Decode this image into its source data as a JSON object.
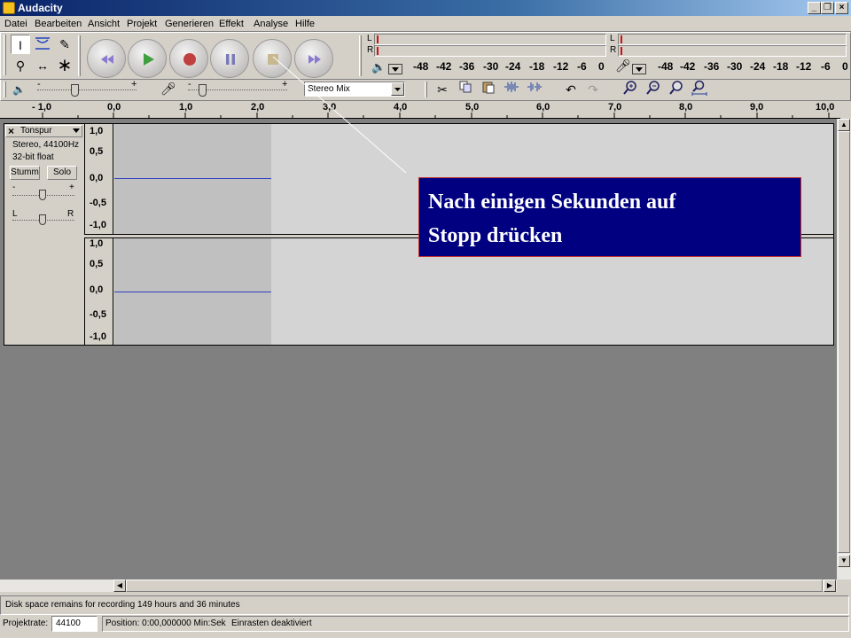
{
  "window": {
    "title": "Audacity"
  },
  "menu": [
    "Datei",
    "Bearbeiten",
    "Ansicht",
    "Projekt",
    "Generieren",
    "Effekt",
    "Analyse",
    "Hilfe"
  ],
  "meters": {
    "output_scale": [
      "-48",
      "-42",
      "-36",
      "-30",
      "-24",
      "-18",
      "-12",
      "-6",
      "0"
    ],
    "input_scale": [
      "-48",
      "-42",
      "-36",
      "-30",
      "-24",
      "-18",
      "-12",
      "-6",
      "0"
    ],
    "channel_l": "L",
    "channel_r": "R"
  },
  "mixer": {
    "minus": "-",
    "plus": "+",
    "input_source": "Stereo Mix"
  },
  "ruler": [
    "- 1,0",
    "0,0",
    "1,0",
    "2,0",
    "3,0",
    "4,0",
    "5,0",
    "6,0",
    "7,0",
    "8,0",
    "9,0",
    "10,0"
  ],
  "track": {
    "name": "Tonspur",
    "info_line1": "Stereo, 44100Hz",
    "info_line2": "32-bit float",
    "mute_label": "Stumm",
    "solo_label": "Solo",
    "gain_minus": "-",
    "gain_plus": "+",
    "pan_left": "L",
    "pan_right": "R",
    "scale": [
      "1,0",
      "0,5",
      "0,0",
      "-0,5",
      "-1,0"
    ]
  },
  "callout": {
    "line1": "Nach einigen Sekunden auf",
    "line2": "Stopp drücken"
  },
  "status": {
    "disk_space": "Disk space remains for recording 149 hours and 36 minutes",
    "rate_label": "Projektrate:",
    "rate_value": "44100",
    "position": "Position: 0:00,000000 Min:Sek",
    "snap": "Einrasten deaktiviert"
  },
  "colors": {
    "callout_bg": "#000080",
    "waveform_line": "#3040c0",
    "record_red": "#c04040",
    "play_green": "#40a040"
  }
}
